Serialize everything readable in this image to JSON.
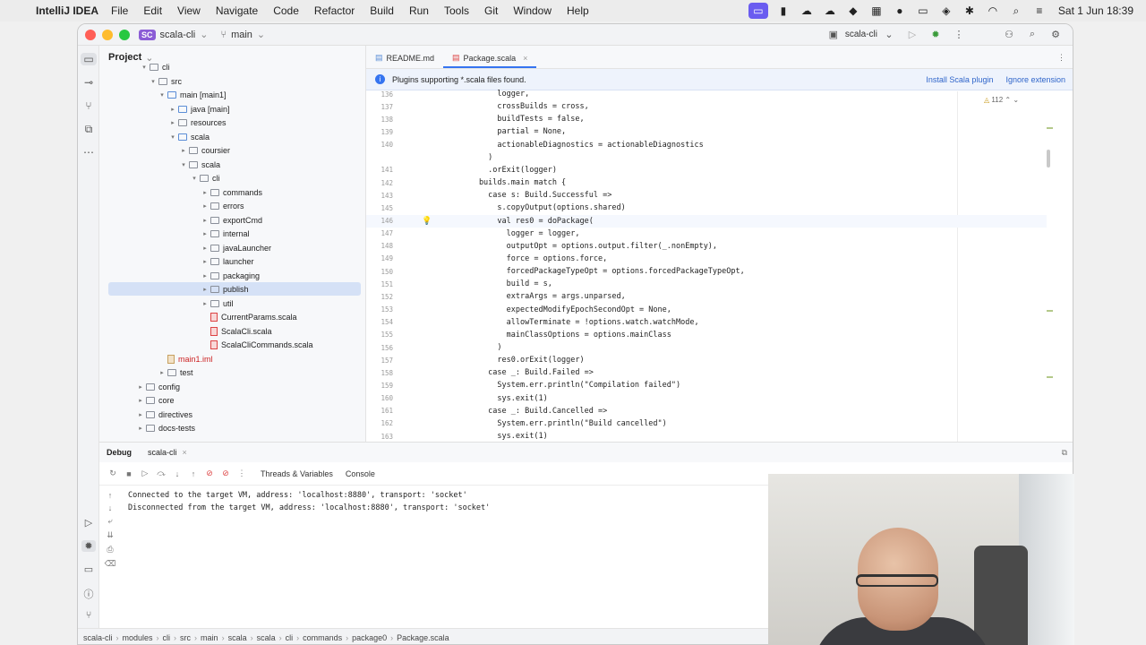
{
  "macbar": {
    "app_name": "IntelliJ IDEA",
    "menus": [
      "File",
      "Edit",
      "View",
      "Navigate",
      "Code",
      "Refactor",
      "Build",
      "Run",
      "Tools",
      "Git",
      "Window",
      "Help"
    ],
    "clock": "Sat 1 Jun  18:39"
  },
  "titlebar": {
    "project_badge": "SC",
    "project_name": "scala-cli",
    "branch": "main",
    "run_config": "scala-cli"
  },
  "project_panel": {
    "title": "Project",
    "tree": [
      {
        "label": "cli",
        "type": "folder"
      },
      {
        "label": "src",
        "type": "folder"
      },
      {
        "label": "main [main1]",
        "type": "folder-blue"
      },
      {
        "label": "java [main]",
        "type": "folder-blue"
      },
      {
        "label": "resources",
        "type": "folder"
      },
      {
        "label": "scala",
        "type": "folder-blue"
      },
      {
        "label": "coursier",
        "type": "folder"
      },
      {
        "label": "scala",
        "type": "folder"
      },
      {
        "label": "cli",
        "type": "folder"
      },
      {
        "label": "commands",
        "type": "folder"
      },
      {
        "label": "errors",
        "type": "folder"
      },
      {
        "label": "exportCmd",
        "type": "folder"
      },
      {
        "label": "internal",
        "type": "folder"
      },
      {
        "label": "javaLauncher",
        "type": "folder"
      },
      {
        "label": "launcher",
        "type": "folder"
      },
      {
        "label": "packaging",
        "type": "folder"
      },
      {
        "label": "publish",
        "type": "folder"
      },
      {
        "label": "util",
        "type": "folder"
      },
      {
        "label": "CurrentParams.scala",
        "type": "file"
      },
      {
        "label": "ScalaCli.scala",
        "type": "file"
      },
      {
        "label": "ScalaCliCommands.scala",
        "type": "file"
      },
      {
        "label": "main1.iml",
        "type": "iml"
      },
      {
        "label": "test",
        "type": "folder"
      },
      {
        "label": "config",
        "type": "folder"
      },
      {
        "label": "core",
        "type": "folder"
      },
      {
        "label": "directives",
        "type": "folder"
      },
      {
        "label": "docs-tests",
        "type": "folder"
      }
    ]
  },
  "editor": {
    "tabs": [
      {
        "label": "README.md"
      },
      {
        "label": "Package.scala"
      }
    ],
    "banner": {
      "message": "Plugins supporting *.scala files found.",
      "install": "Install Scala plugin",
      "ignore": "Ignore extension"
    },
    "inspection_count": "112",
    "lines": [
      {
        "num": "136",
        "text": "            logger,"
      },
      {
        "num": "137",
        "text": "            crossBuilds = cross,"
      },
      {
        "num": "138",
        "text": "            buildTests = false,"
      },
      {
        "num": "139",
        "text": "            partial = None,"
      },
      {
        "num": "140",
        "text": "            actionableDiagnostics = actionableDiagnostics"
      },
      {
        "num": "",
        "text": "          )"
      },
      {
        "num": "141",
        "text": "          .orExit(logger)"
      },
      {
        "num": "142",
        "text": "        builds.main match {"
      },
      {
        "num": "143",
        "text": "          case s: Build.Successful =>"
      },
      {
        "num": "145",
        "text": "            s.copyOutput(options.shared)"
      },
      {
        "num": "146",
        "text": "            val res0 = doPackage("
      },
      {
        "num": "147",
        "text": "              logger = logger,"
      },
      {
        "num": "148",
        "text": "              outputOpt = options.output.filter(_.nonEmpty),"
      },
      {
        "num": "149",
        "text": "              force = options.force,"
      },
      {
        "num": "150",
        "text": "              forcedPackageTypeOpt = options.forcedPackageTypeOpt,"
      },
      {
        "num": "151",
        "text": "              build = s,"
      },
      {
        "num": "152",
        "text": "              extraArgs = args.unparsed,"
      },
      {
        "num": "153",
        "text": "              expectedModifyEpochSecondOpt = None,"
      },
      {
        "num": "154",
        "text": "              allowTerminate = !options.watch.watchMode,"
      },
      {
        "num": "155",
        "text": "              mainClassOptions = options.mainClass"
      },
      {
        "num": "156",
        "text": "            )"
      },
      {
        "num": "157",
        "text": "            res0.orExit(logger)"
      },
      {
        "num": "158",
        "text": "          case _: Build.Failed =>"
      },
      {
        "num": "159",
        "text": "            System.err.println(\"Compilation failed\")"
      },
      {
        "num": "160",
        "text": "            sys.exit(1)"
      },
      {
        "num": "161",
        "text": "          case _: Build.Cancelled =>"
      },
      {
        "num": "162",
        "text": "            System.err.println(\"Build cancelled\")"
      },
      {
        "num": "163",
        "text": "            sys.exit(1)"
      }
    ]
  },
  "debug": {
    "title": "Debug",
    "session": "scala-cli",
    "tabs": [
      "Threads & Variables",
      "Console"
    ],
    "console": [
      "Connected to the target VM, address: 'localhost:8880', transport: 'socket'",
      "Disconnected from the target VM, address: 'localhost:8880', transport: 'socket'"
    ]
  },
  "statusbar": {
    "crumbs": [
      "scala-cli",
      "modules",
      "cli",
      "src",
      "main",
      "scala",
      "scala",
      "cli",
      "commands",
      "package0",
      "Package.scala"
    ]
  }
}
